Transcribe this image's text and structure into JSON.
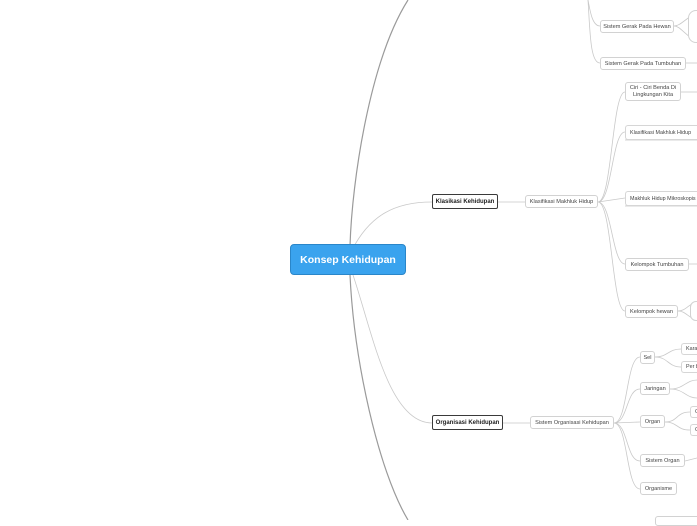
{
  "root": "Konsep Kehidupan",
  "main_topics": {
    "klasifikasi": "Klasikasi Kehidupan",
    "organisasi": "Organisasi Kehidupan"
  },
  "top_branch": {
    "gerak_hewan": "Sistem Gerak Pada Hewan",
    "gerak_tumbuhan": "Sistem Gerak Pada Tumbuhan"
  },
  "klasifikasi_branch": {
    "child": "Klasifikasi Makhluk Hidup",
    "items": [
      "Ciri - Ciri Benda Di Lingkungan Kita",
      "Klasifikasi Makhluk Hidup",
      "Makhluk Hidup Mikroskopis",
      "Kelompok Tumbuhan",
      "Kelompok hewan"
    ]
  },
  "organisasi_branch": {
    "child": "Sistem Organisasi Kehidupan",
    "items": [
      "Sel",
      "Jaringan",
      "Organ",
      "Sistem Organ",
      "Organisme"
    ],
    "sel_children": [
      "Kara",
      "Per b"
    ],
    "organ_children": [
      "C",
      "C"
    ]
  }
}
